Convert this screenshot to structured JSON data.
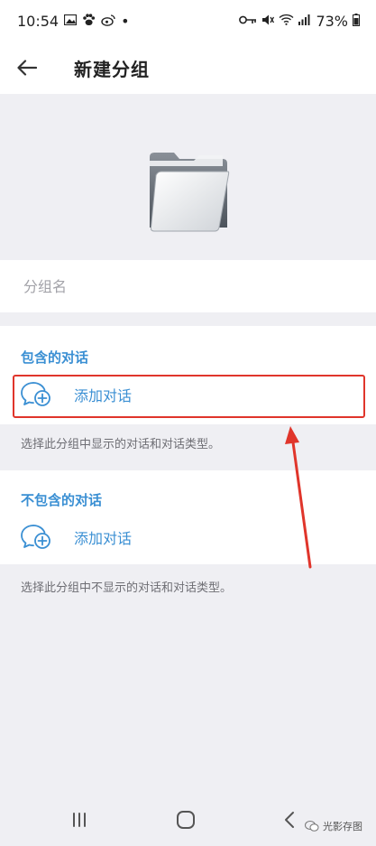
{
  "status_bar": {
    "time": "10:54",
    "battery": "73%",
    "dot": "•"
  },
  "app_bar": {
    "title": "新建分组"
  },
  "name_field": {
    "placeholder": "分组名",
    "value": ""
  },
  "include_section": {
    "title": "包含的对话",
    "add_label": "添加对话",
    "hint": "选择此分组中显示的对话和对话类型。"
  },
  "exclude_section": {
    "title": "不包含的对话",
    "add_label": "添加对话",
    "hint": "选择此分组中不显示的对话和对话类型。"
  },
  "watermark": {
    "text": "光影存图"
  },
  "colors": {
    "accent": "#3a8fd3",
    "highlight": "#e0352b",
    "background": "#efeff3"
  },
  "icons": {
    "back": "arrow-left-icon",
    "folder": "folder-icon",
    "add_chat": "chat-add-icon",
    "nav_recent": "recent-apps-icon",
    "nav_home": "home-icon",
    "nav_back": "nav-back-icon"
  }
}
